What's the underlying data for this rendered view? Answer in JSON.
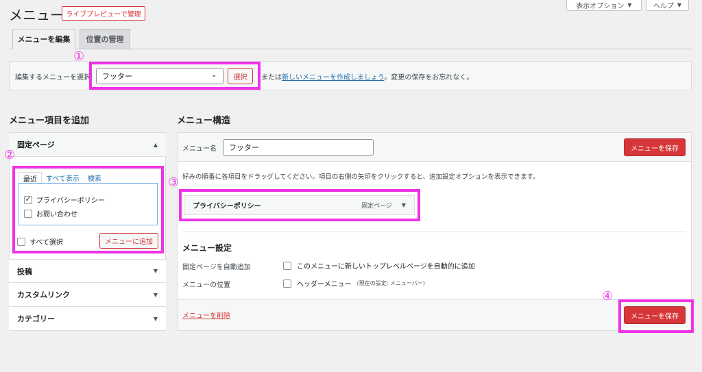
{
  "header": {
    "title": "メニュー",
    "live_preview_label": "ライブプレビューで管理",
    "screen_options_label": "表示オプション",
    "help_label": "ヘルプ"
  },
  "tabs": [
    {
      "label": "メニューを編集",
      "active": true
    },
    {
      "label": "位置の管理",
      "active": false
    }
  ],
  "select_bar": {
    "label": "編集するメニューを選択:",
    "selected_menu": "フッター",
    "select_button": "選択",
    "text_before": "または",
    "create_link": "新しいメニューを作成しましょう",
    "text_after": "。変更の保存をお忘れなく。"
  },
  "left": {
    "heading": "メニュー項目を追加",
    "sections": [
      {
        "label": "固定ページ",
        "expanded": true
      },
      {
        "label": "投稿",
        "expanded": false
      },
      {
        "label": "カスタムリンク",
        "expanded": false
      },
      {
        "label": "カテゴリー",
        "expanded": false
      }
    ],
    "subtabs": [
      {
        "label": "最近",
        "active": true
      },
      {
        "label": "すべて表示",
        "active": false
      },
      {
        "label": "検索",
        "active": false
      }
    ],
    "pages": [
      {
        "label": "プライバシーポリシー",
        "checked": true
      },
      {
        "label": "お問い合わせ",
        "checked": false
      }
    ],
    "select_all_label": "すべて選択",
    "add_button": "メニューに追加"
  },
  "right": {
    "heading": "メニュー構造",
    "menu_name_label": "メニュー名",
    "menu_name_value": "フッター",
    "save_button": "メニューを保存",
    "instructions": "好みの順番に各項目をドラッグしてください。項目の右側の矢印をクリックすると、追加設定オプションを表示できます。",
    "menu_items": [
      {
        "title": "プライバシーポリシー",
        "type": "固定ページ"
      }
    ],
    "settings_heading": "メニュー設定",
    "auto_add_label": "固定ページを自動追加",
    "auto_add_option": "このメニューに新しいトップレベルページを自動的に追加",
    "location_label": "メニューの位置",
    "location_option": "ヘッダーメニュー",
    "location_note": "(現在の設定: メニューバー)",
    "delete_link": "メニューを削除"
  },
  "annotations": [
    "①",
    "②",
    "③",
    "④"
  ],
  "colors": {
    "accent": "#d63638",
    "link": "#2271b1",
    "highlight": "#ee33e6",
    "background": "#f0f0f1"
  }
}
